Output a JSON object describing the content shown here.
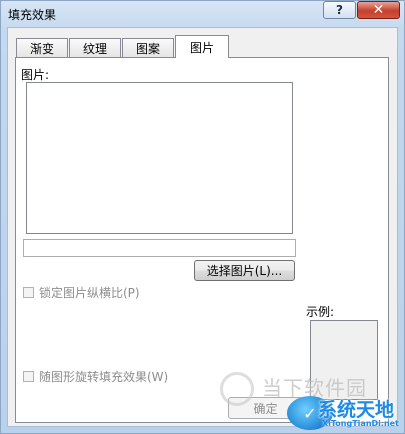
{
  "window": {
    "title": "填充效果",
    "help_symbol": "?",
    "close_symbol": "✕"
  },
  "tabs": [
    {
      "label": "渐变"
    },
    {
      "label": "纹理"
    },
    {
      "label": "图案"
    },
    {
      "label": "图片",
      "active": true
    }
  ],
  "picture_tab": {
    "picture_label": "图片:",
    "filename_value": "",
    "select_button": "选择图片(L)...",
    "lock_aspect_label": "锁定图片纵横比(P)",
    "lock_aspect_checked": false,
    "rotate_label": "随图形旋转填充效果(W)",
    "rotate_checked": false,
    "sample_label": "示例:"
  },
  "buttons": {
    "ok": "确定"
  },
  "watermarks": {
    "top_text": "当下软件园",
    "badge_symbol": "✓",
    "main_text": "系统天地",
    "sub_text": "XiTongTianDi.net"
  },
  "colors": {
    "title_bar": "#c4d8ee",
    "close_button": "#c2402c",
    "panel_background": "#ffffff",
    "dialog_background": "#f0f0f0",
    "watermark_blue": "#1d8be6"
  }
}
